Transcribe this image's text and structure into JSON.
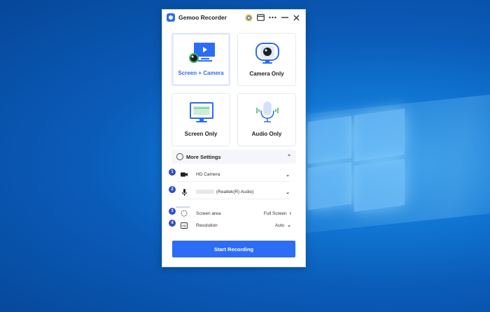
{
  "window": {
    "title": "Gemoo Recorder"
  },
  "modes": [
    {
      "label": "Screen + Camera",
      "selected": true
    },
    {
      "label": "Camera Only",
      "selected": false
    },
    {
      "label": "Screen Only",
      "selected": false
    },
    {
      "label": "Audio Only",
      "selected": false
    }
  ],
  "more_settings": {
    "label": "More Settings"
  },
  "settings": {
    "camera": {
      "badge": "1",
      "value": "HD Camera"
    },
    "microphone": {
      "badge": "2",
      "value": "(Realtek(R) Audio)"
    },
    "screen_area": {
      "badge": "3",
      "label": "Screen area",
      "value": "Full Screen"
    },
    "resolution": {
      "badge": "4",
      "label": "Resolution",
      "value": "Auto"
    }
  },
  "start_button": {
    "label": "Start Recording"
  },
  "colors": {
    "accent": "#2d6cf5",
    "badge": "#2d4fc4",
    "audio": "#3bb36a"
  }
}
